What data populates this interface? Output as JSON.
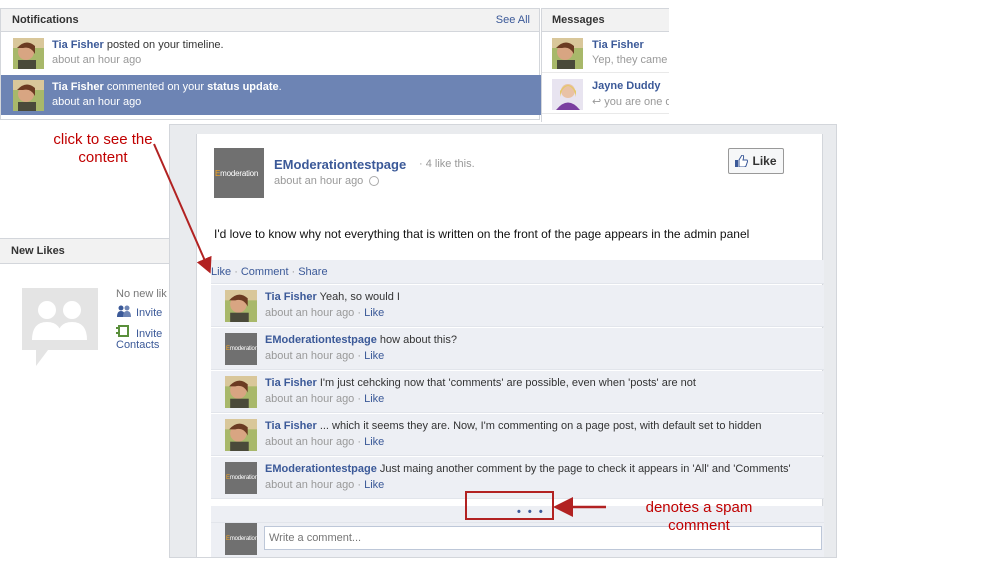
{
  "notifications": {
    "title": "Notifications",
    "see_all": "See All",
    "items": [
      {
        "name": "Tia Fisher",
        "text": " posted on your timeline.",
        "bold": "",
        "time": "about an hour ago"
      },
      {
        "name": "Tia Fisher",
        "text": " commented on your ",
        "bold": "status update",
        "suffix": ".",
        "time": "about an hour ago"
      }
    ]
  },
  "messages": {
    "title": "Messages",
    "items": [
      {
        "name": "Tia Fisher",
        "snippet": "Yep, they came"
      },
      {
        "name": "Jayne Duddy",
        "snippet": "↩ you are one o"
      }
    ]
  },
  "new_likes": {
    "title": "New Likes",
    "no_new": "No new lik",
    "invite1": "Invite",
    "invite2": "Invite",
    "contacts": "Contacts"
  },
  "post": {
    "page_name": "EModerationtestpage",
    "like_count": " · 4 like this.",
    "time": "about an hour ago",
    "like_button": "Like",
    "text": "I'd love to know why not everything that is written on the front of the page appears in the admin panel",
    "actions": {
      "like": "Like",
      "comment": "Comment",
      "share": "Share"
    },
    "logo_text": "moderation",
    "logo_e": "E",
    "comments": [
      {
        "author": "Tia Fisher",
        "text": " Yeah, so would I",
        "time": "about an hour ago",
        "like": "Like",
        "avatar": "person"
      },
      {
        "author": "EModerationtestpage",
        "text": " how about this?",
        "time": "about an hour ago",
        "like": "Like",
        "avatar": "page"
      },
      {
        "author": "Tia Fisher",
        "text": " I'm just cehcking now that 'comments' are possible, even when 'posts' are not",
        "time": "about an hour ago",
        "like": "Like",
        "avatar": "person"
      },
      {
        "author": "Tia Fisher",
        "text": " ... which it seems they are. Now, I'm commenting on a page post, with default set to hidden",
        "time": "about an hour ago",
        "like": "Like",
        "avatar": "person"
      },
      {
        "author": "EModerationtestpage",
        "text": " Just maing another comment by the page to check it appears in 'All' and 'Comments'",
        "time": "about an hour ago",
        "like": "Like",
        "avatar": "page"
      }
    ],
    "spam_dots": "• • •",
    "write_placeholder": "Write a comment..."
  },
  "annotations": {
    "click_note_line1": "click to see the",
    "click_note_line2": "content",
    "spam_note_line1": "denotes a spam",
    "spam_note_line2": "comment",
    "color": "#c00000"
  },
  "colors": {
    "link": "#3b5998",
    "selected_row": "#6d84b4",
    "panel_header": "#f2f2f2",
    "comment_bg": "#edeff4"
  }
}
